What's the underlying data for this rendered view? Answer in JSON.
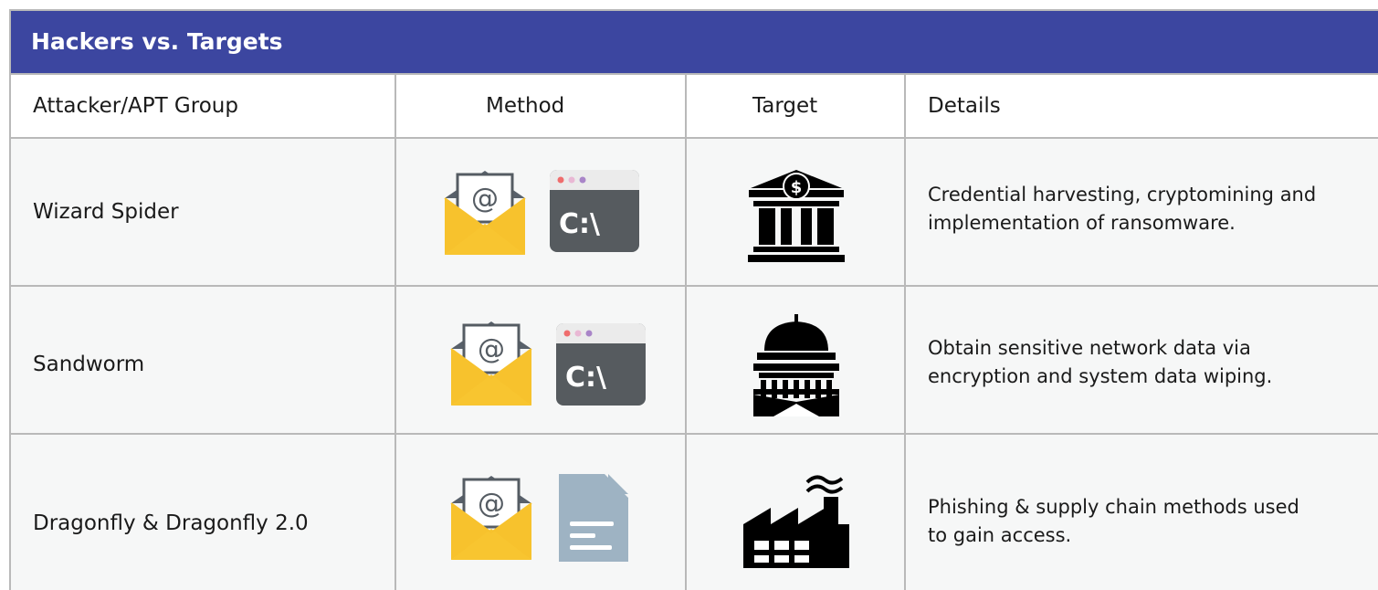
{
  "title": "Hackers vs. Targets",
  "columns": [
    "Attacker/APT Group",
    "Method",
    "Target",
    "Details"
  ],
  "rows": [
    {
      "name": "Wizard Spider",
      "method_icons": [
        "email-icon",
        "terminal-icon"
      ],
      "target_icon": "bank-icon",
      "details_lines": [
        "Credential harvesting, cryptomining and",
        "implementation of ransomware."
      ]
    },
    {
      "name": "Sandworm",
      "method_icons": [
        "email-icon",
        "terminal-icon"
      ],
      "target_icon": "government-building-icon",
      "details_lines": [
        "Obtain sensitive network data via",
        "encryption and system data wiping."
      ]
    },
    {
      "name": "Dragonfly & Dragonfly 2.0",
      "method_icons": [
        "email-icon",
        "document-icon"
      ],
      "target_icon": "factory-icon",
      "details_lines": [
        "Phishing & supply chain methods used",
        "to gain access."
      ]
    }
  ],
  "terminal_text": "C:\\",
  "email_symbol": "@",
  "bank_symbol": "$",
  "colors": {
    "title_bar": "#3c46a0",
    "row_bg": "#f6f7f7",
    "border": "#b9b9b9",
    "envelope_yellow": "#f7c22d",
    "terminal_gray": "#565b5f",
    "document_blue": "#9eb3c3"
  }
}
